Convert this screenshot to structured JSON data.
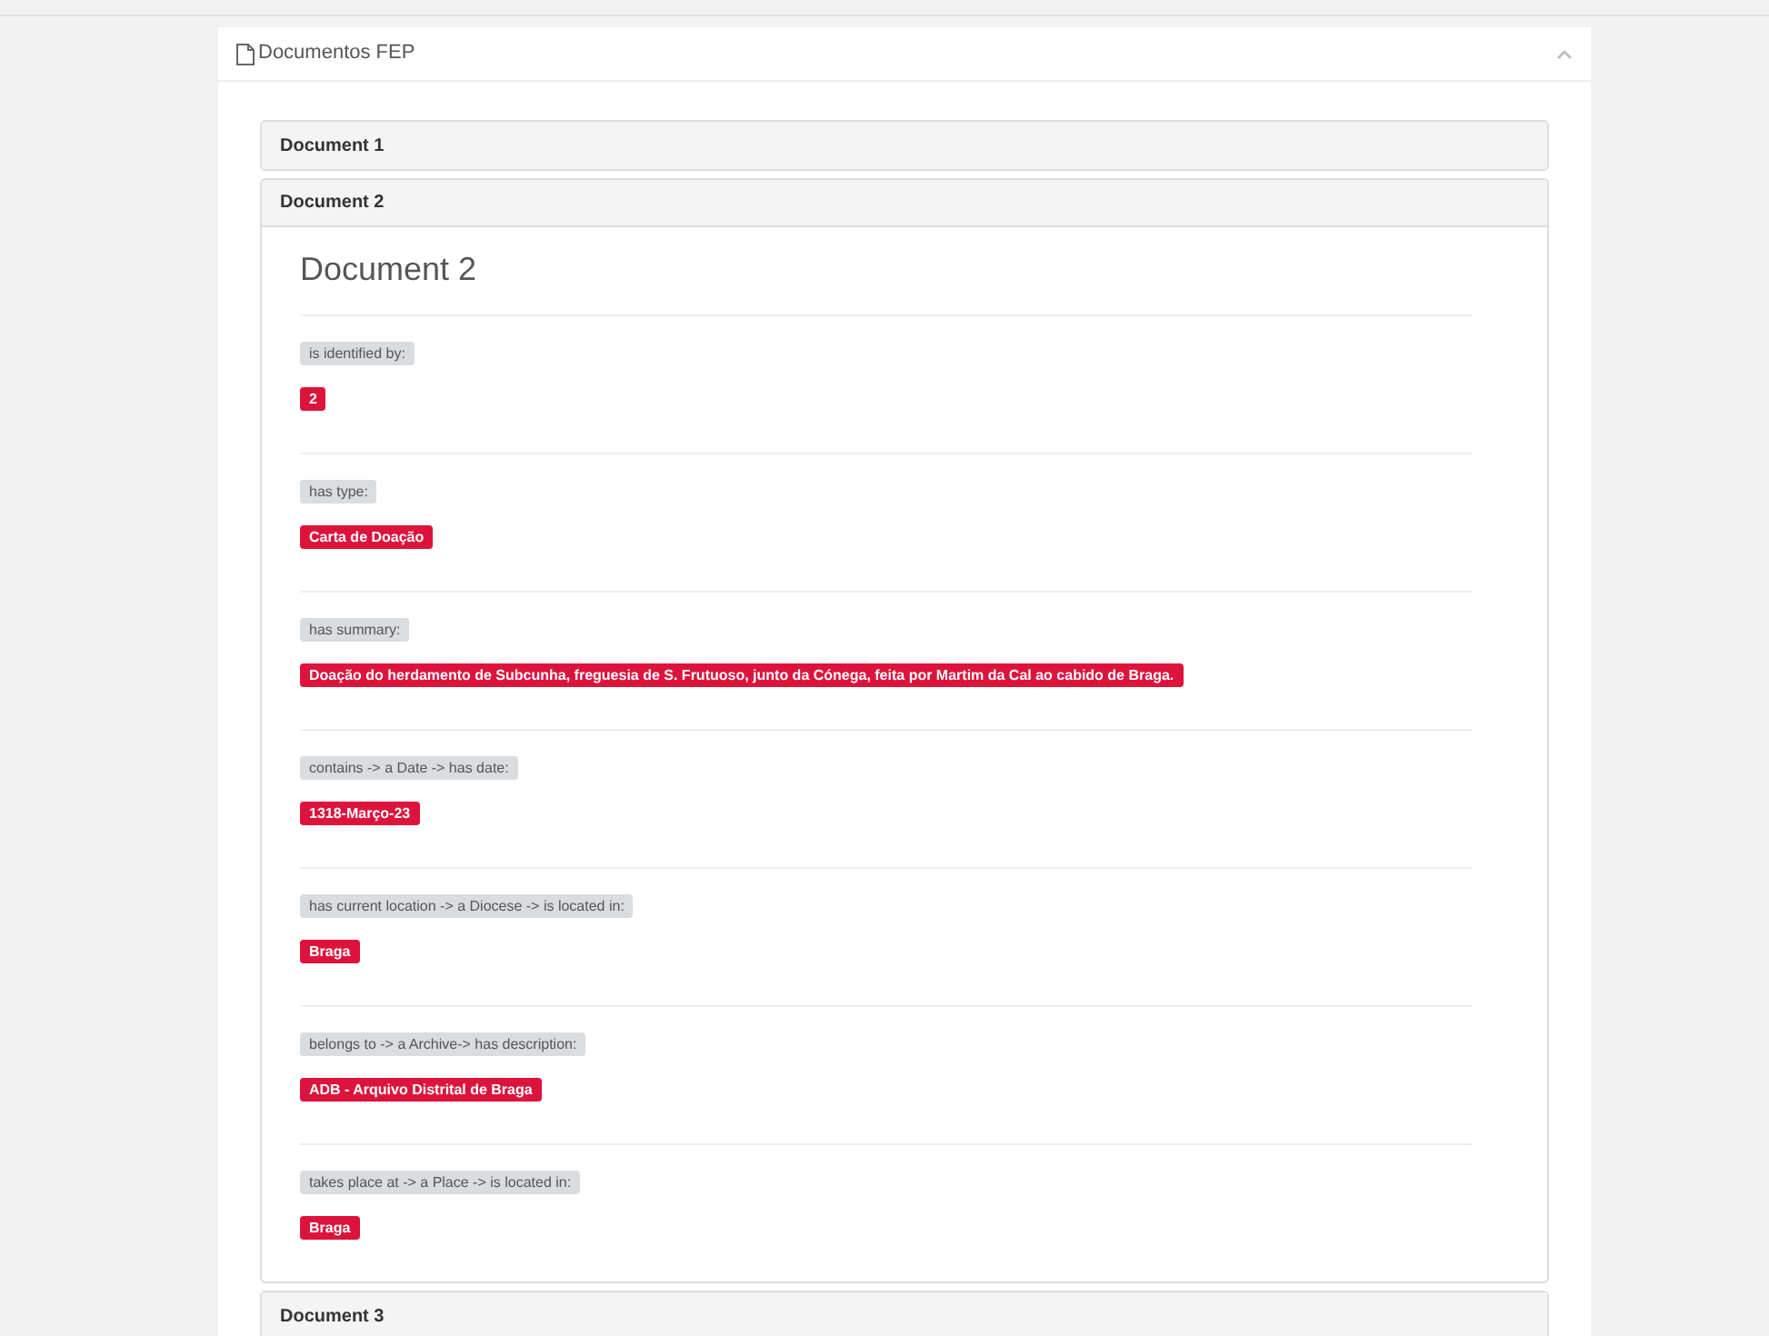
{
  "panel": {
    "title": "Documentos FEP",
    "expanded": true
  },
  "documents": [
    {
      "title": "Document 1",
      "expanded": false
    },
    {
      "title": "Document 2",
      "expanded": true,
      "heading": "Document 2",
      "properties": [
        {
          "label": "is identified by:",
          "value": "2"
        },
        {
          "label": "has type:",
          "value": "Carta de Doação"
        },
        {
          "label": "has summary:",
          "value": "Doação do herdamento de Subcunha, freguesia de S. Frutuoso, junto da Cónega, feita por Martim da Cal ao cabido de Braga."
        },
        {
          "label": "contains -> a Date -> has date:",
          "value": "1318-Março-23"
        },
        {
          "label": "has current location -> a Diocese -> is located in:",
          "value": "Braga"
        },
        {
          "label": "belongs to -> a Archive-> has description:",
          "value": "ADB - Arquivo Distrital de Braga"
        },
        {
          "label": "takes place at -> a Place -> is located in:",
          "value": "Braga"
        }
      ]
    },
    {
      "title": "Document 3",
      "expanded": false
    }
  ]
}
